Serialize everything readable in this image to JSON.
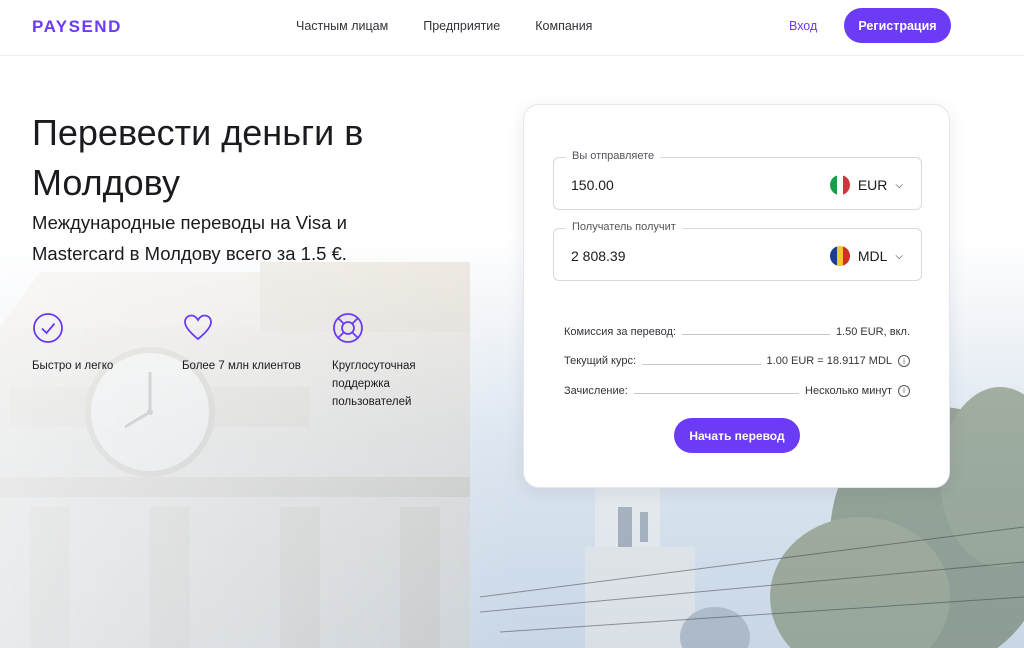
{
  "header": {
    "logo": "PAYSEND",
    "nav": [
      "Частным лицам",
      "Предприятие",
      "Компания"
    ],
    "login": "Вход",
    "register": "Регистрация"
  },
  "hero": {
    "title": "Перевести деньги в Молдову",
    "subtitle": "Международные переводы на Visa и Mastercard в Молдову всего за 1.5 €.",
    "features": [
      {
        "icon": "check-circle-icon",
        "label": "Быстро и легко"
      },
      {
        "icon": "heart-icon",
        "label": "Более 7 млн клиентов"
      },
      {
        "icon": "lifebuoy-icon",
        "label": "Круглосуточная поддержка пользователей"
      }
    ]
  },
  "calculator": {
    "send": {
      "label": "Вы отправляете",
      "value": "150.00",
      "currency": "EUR"
    },
    "receive": {
      "label": "Получатель получит",
      "value": "2 808.39",
      "currency": "MDL"
    },
    "rows": [
      {
        "label": "Комиссия за перевод:",
        "value": "1.50 EUR, вкл."
      },
      {
        "label": "Текущий курс:",
        "value": "1.00 EUR = 18.9117 MDL"
      },
      {
        "label": "Зачисление:",
        "value": "Несколько минут"
      }
    ],
    "button": "Начать перевод"
  },
  "colors": {
    "accent": "#6b3bf5"
  }
}
